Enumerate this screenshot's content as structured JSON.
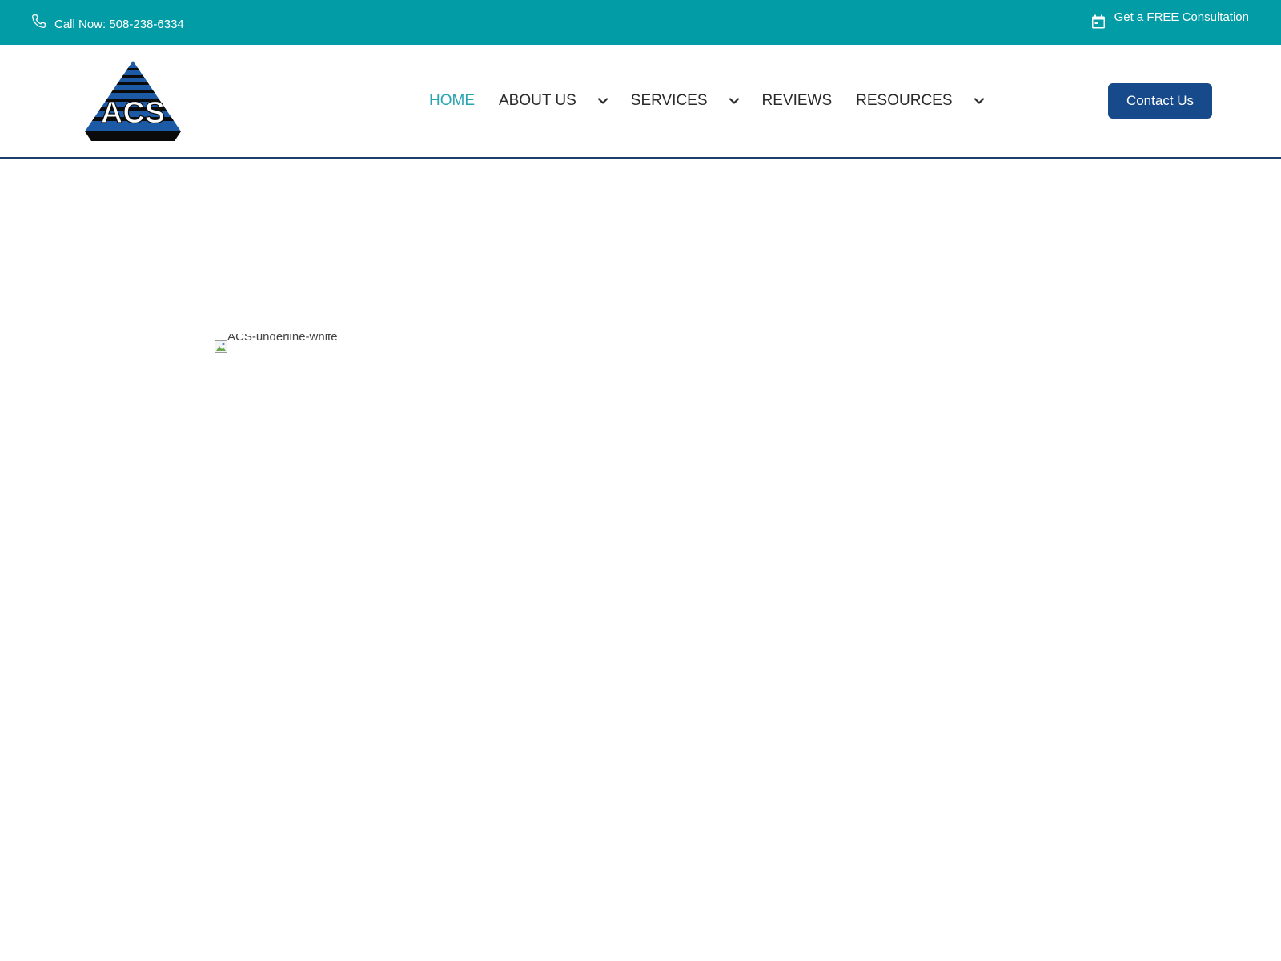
{
  "topbar": {
    "call_label": "Call Now: 508-238-6334",
    "consult_label": "Get a FREE Consultation",
    "background": "#029ca6",
    "phone_icon": "phone-icon",
    "calendar_icon": "calendar-icon"
  },
  "header": {
    "logo_text": "ACS",
    "nav": {
      "home": "HOME",
      "about": "ABOUT US",
      "services": "SERVICES",
      "reviews": "REVIEWS",
      "resources": "RESOURCES"
    },
    "active_item": "HOME",
    "active_color": "#2aa4b0",
    "contact_button": "Contact Us",
    "contact_button_color": "#174a8b"
  },
  "main": {
    "image_alt": "ACS-underline-white"
  }
}
